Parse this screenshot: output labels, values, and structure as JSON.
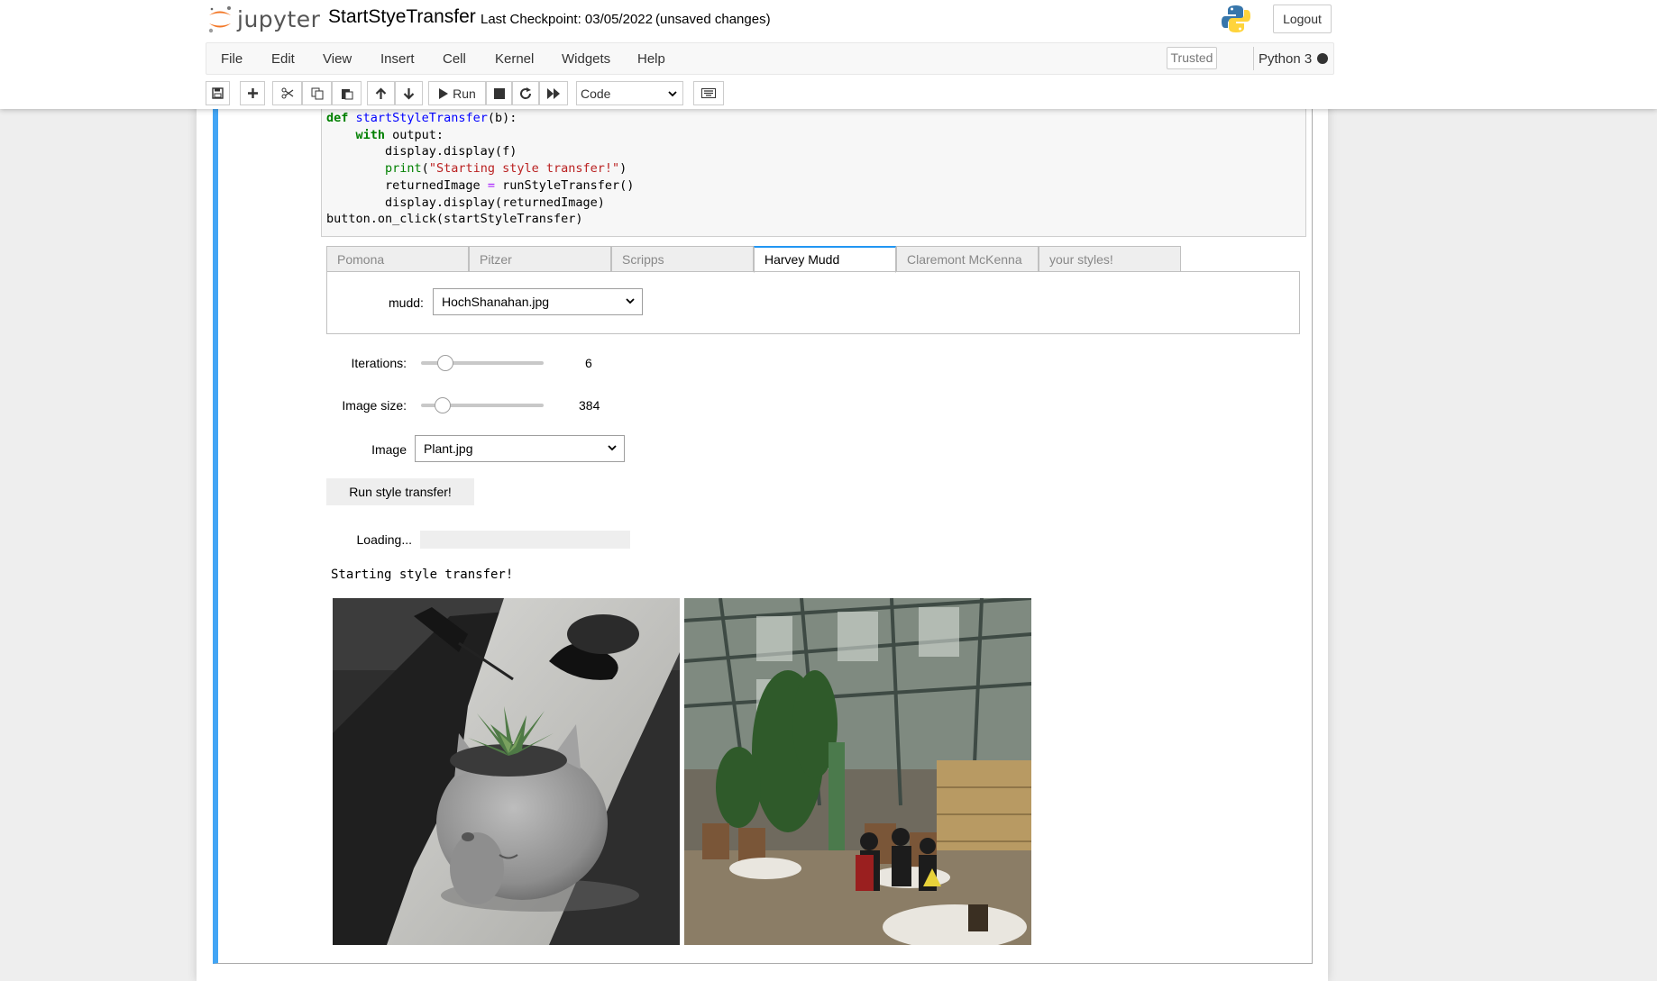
{
  "header": {
    "logo_text": "jupyter",
    "notebook_name": "StartStyeTransfer",
    "checkpoint": "Last Checkpoint: 03/05/2022",
    "autosave": "(unsaved changes)",
    "logout_label": "Logout"
  },
  "menubar": {
    "items": [
      "File",
      "Edit",
      "View",
      "Insert",
      "Cell",
      "Kernel",
      "Widgets",
      "Help"
    ],
    "trusted": "Trusted",
    "kernel": "Python 3"
  },
  "toolbar": {
    "run_label": "Run",
    "cell_type": "Code"
  },
  "code_lines": [
    "def startStyleTransfer(b):",
    "    with output:",
    "        display.display(f)",
    "        print(\"Starting style transfer!\")",
    "        returnedImage = runStyleTransfer()",
    "        display.display(returnedImage)",
    "button.on_click(startStyleTransfer)"
  ],
  "tabs": {
    "items": [
      "Pomona",
      "Pitzer",
      "Scripps",
      "Harvey Mudd",
      "Claremont McKenna",
      "your styles!"
    ],
    "active_index": 3
  },
  "style_picker": {
    "label": "mudd:",
    "value": "HochShanahan.jpg"
  },
  "iterations": {
    "label": "Iterations:",
    "value": "6",
    "fraction": 0.2
  },
  "image_size": {
    "label": "Image size:",
    "value": "384",
    "fraction": 0.18
  },
  "image_picker": {
    "label": "Image",
    "value": "Plant.jpg"
  },
  "run_button_label": "Run style transfer!",
  "loading": {
    "label": "Loading...",
    "progress": 0
  },
  "output_text": "Starting style transfer!",
  "images": [
    "content-image-plant",
    "style-image-hoch-shanahan"
  ]
}
